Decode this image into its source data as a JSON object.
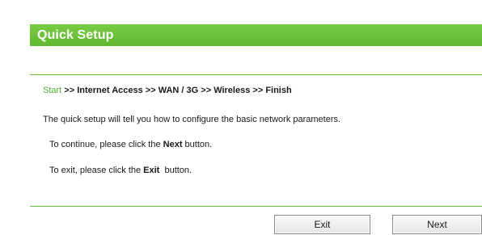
{
  "header": {
    "title": "Quick Setup"
  },
  "steps": {
    "items": [
      "Start",
      "Internet Access",
      "WAN / 3G",
      "Wireless",
      "Finish"
    ],
    "separator": " >> ",
    "active_index": 0
  },
  "body": {
    "intro": "The quick setup will tell you how to configure the basic network parameters.",
    "continue_prefix": "To continue, please click the ",
    "continue_keyword": "Next",
    "continue_suffix": " button.",
    "exit_prefix": "To exit, please click the ",
    "exit_keyword": "Exit",
    "exit_suffix": "  button."
  },
  "buttons": {
    "exit_label": "Exit",
    "next_label": "Next"
  },
  "colors": {
    "accent_green": "#6ec43b",
    "active_step": "#4bb02e",
    "rule": "#6cbd45"
  }
}
